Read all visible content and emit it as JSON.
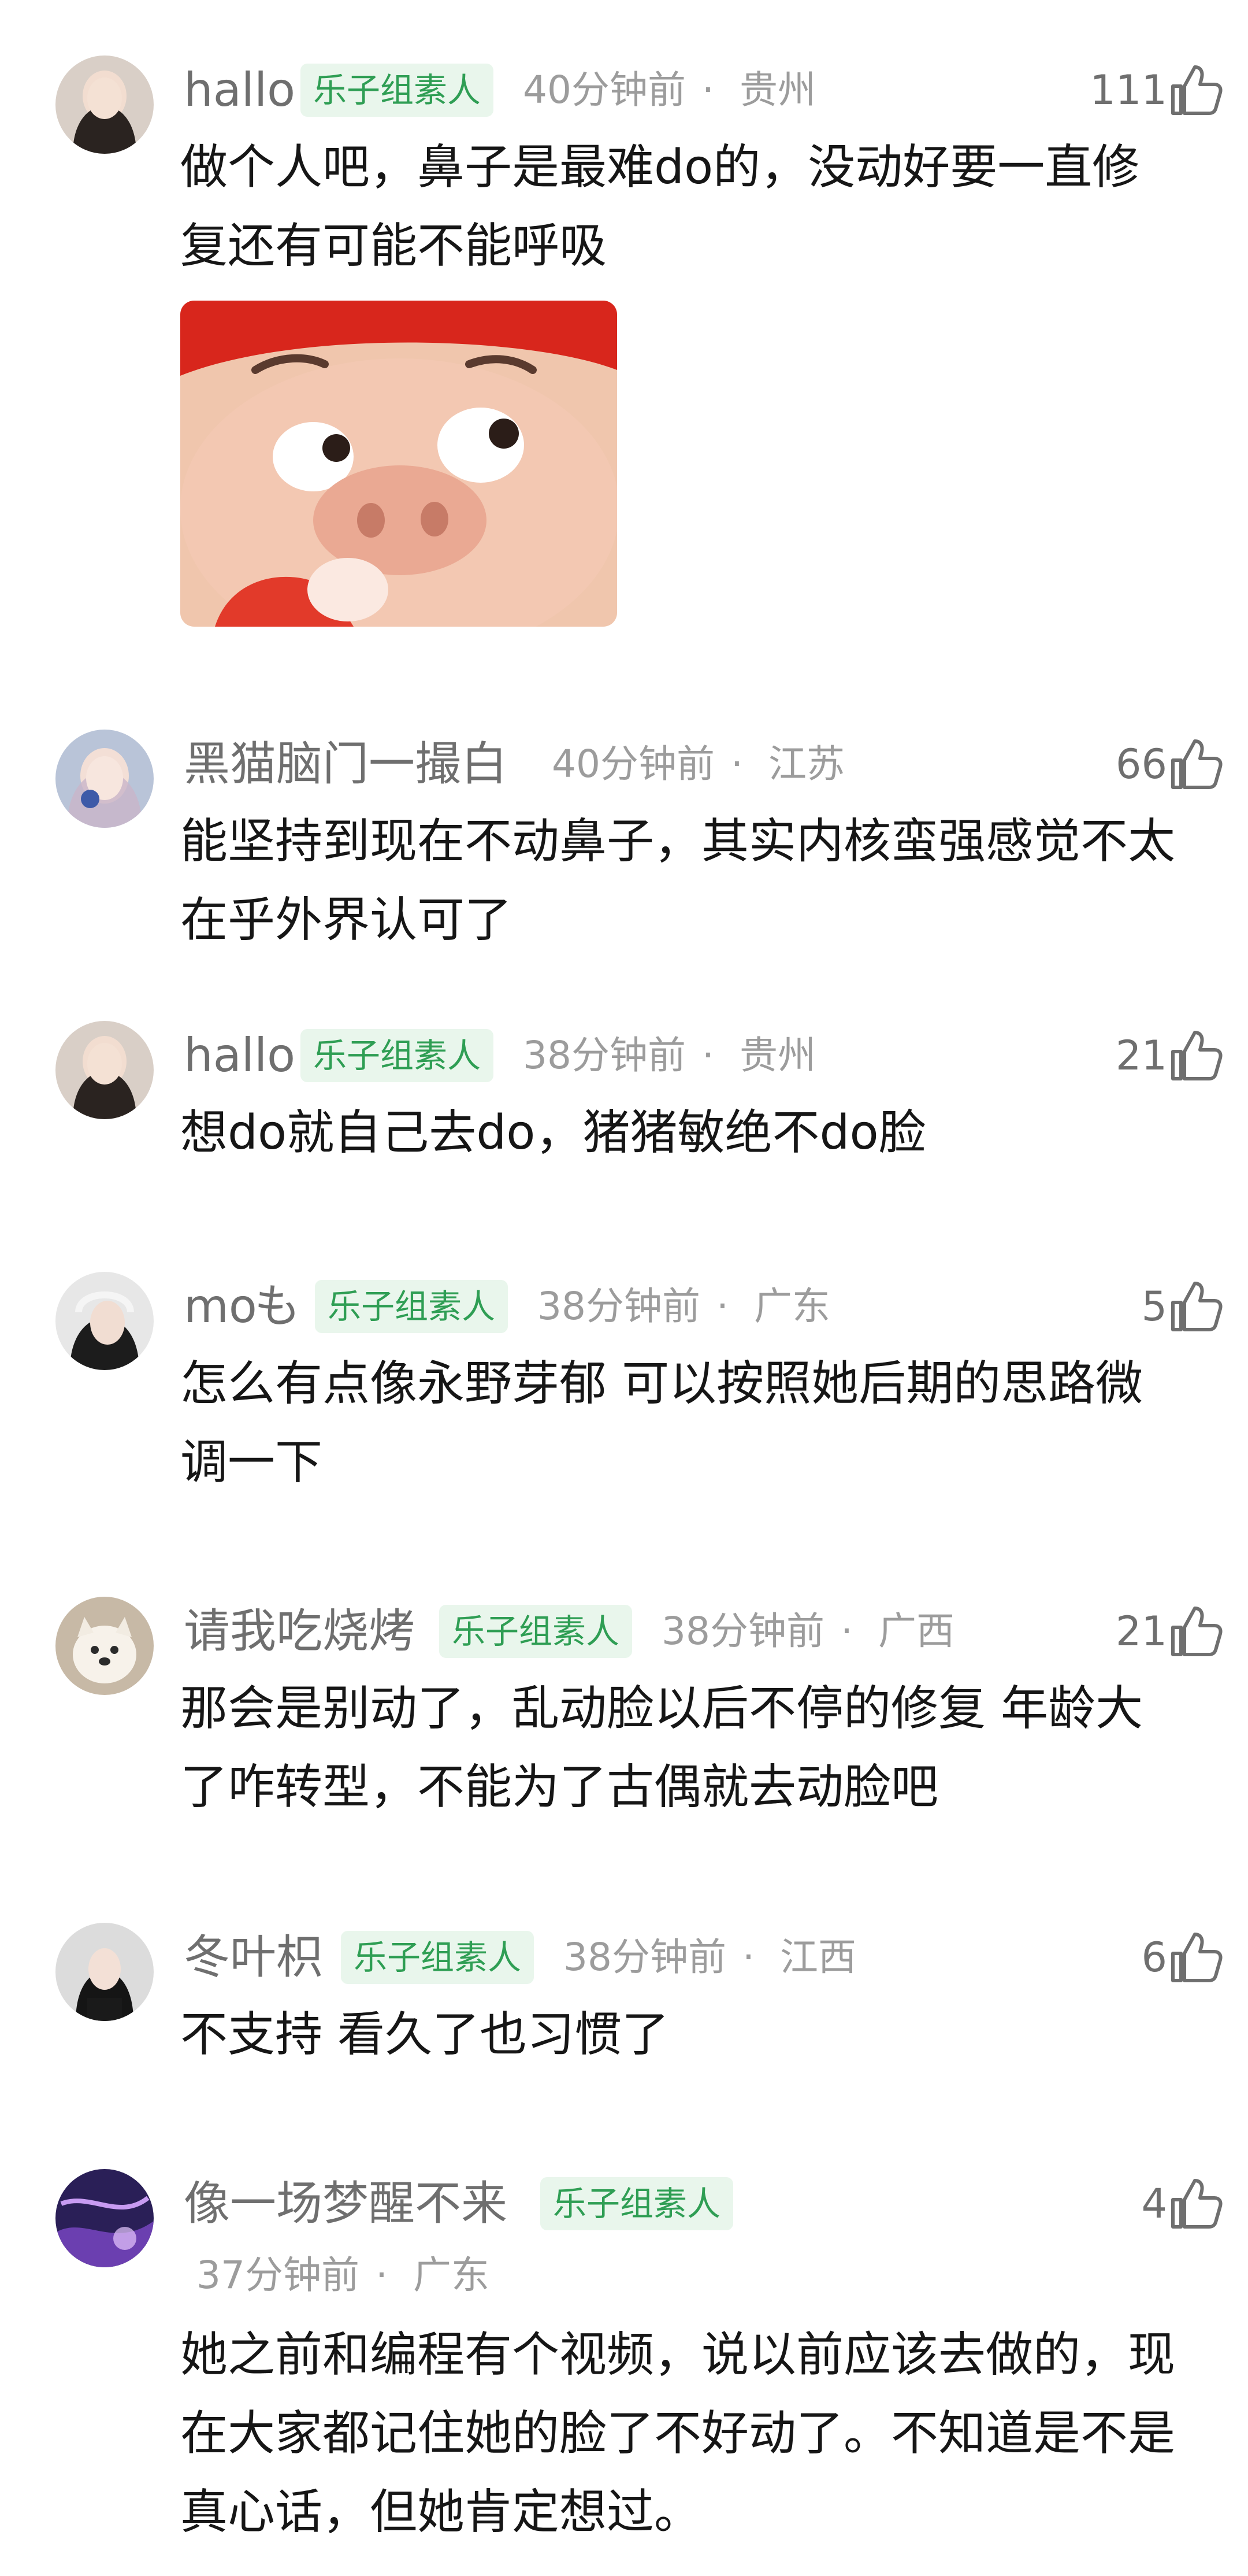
{
  "comments": [
    {
      "username": "hallo",
      "badge": "乐子组素人",
      "time": "40分钟前",
      "location": "贵州",
      "likes": "111",
      "text": "做个人吧，鼻子是最难do的，没动好要一直修复还有可能不能呼吸"
    },
    {
      "username": "黑猫脑门一撮白",
      "badge": "",
      "time": "40分钟前",
      "location": "江苏",
      "likes": "66",
      "text": "能坚持到现在不动鼻子，其实内核蛮强感觉不太在乎外界认可了"
    },
    {
      "username": "hallo",
      "badge": "乐子组素人",
      "time": "38分钟前",
      "location": "贵州",
      "likes": "21",
      "text": "想do就自己去do，猪猪敏绝不do脸"
    },
    {
      "username": "mo",
      "badge": "乐子组素人",
      "time": "38分钟前",
      "location": "广东",
      "likes": "5",
      "text": "怎么有点像永野芽郁 可以按照她后期的思路微调一下"
    },
    {
      "username": "请我吃烧烤",
      "badge": "乐子组素人",
      "time": "38分钟前",
      "location": "广西",
      "likes": "21",
      "text": "那会是别动了，乱动脸以后不停的修复 年龄大了咋转型，不能为了古偶就去动脸吧"
    },
    {
      "username": "冬叶枳",
      "badge": "乐子组素人",
      "time": "38分钟前",
      "location": "江西",
      "likes": "6",
      "text": "不支持 看久了也习惯了"
    },
    {
      "username": "像一场梦醒不来",
      "badge": "乐子组素人",
      "time": "37分钟前",
      "location": "广东",
      "likes": "4",
      "text": "她之前和编程有个视频，说以前应该去做的，现在大家都记住她的脸了不好动了。不知道是不是真心话，但她肯定想过。"
    }
  ],
  "meta_separator": "·",
  "icons": {
    "like": "thumbs-up-icon",
    "username_suffix": "mo-glyph-icon"
  },
  "colors": {
    "badge_text": "#2f9e54",
    "badge_bg": "#e9f6ec",
    "meta": "#9c9c9c",
    "username": "#6f6f6f"
  }
}
